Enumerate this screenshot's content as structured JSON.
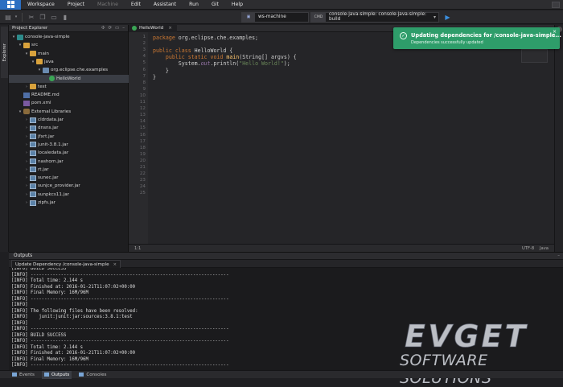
{
  "menu": {
    "items": [
      {
        "label": "Workspace",
        "enabled": true
      },
      {
        "label": "Project",
        "enabled": true
      },
      {
        "label": "Machine",
        "enabled": false
      },
      {
        "label": "Edit",
        "enabled": true
      },
      {
        "label": "Assistant",
        "enabled": true
      },
      {
        "label": "Run",
        "enabled": true
      },
      {
        "label": "Git",
        "enabled": true
      },
      {
        "label": "Help",
        "enabled": true
      }
    ]
  },
  "toolbar": {
    "machine": "ws-machine",
    "cmd_badge": "CMD",
    "command": "console-java-simple: console-java-simple: build"
  },
  "side": {
    "explorer_tab": "Explorer"
  },
  "explorer": {
    "title": "Project Explorer",
    "tree": [
      {
        "label": "console-java-simple",
        "depth": 0,
        "arrow": "▾",
        "icon": "proj"
      },
      {
        "label": "src",
        "depth": 1,
        "arrow": "▾",
        "icon": "folder"
      },
      {
        "label": "main",
        "depth": 2,
        "arrow": "▾",
        "icon": "folder"
      },
      {
        "label": "java",
        "depth": 3,
        "arrow": "▾",
        "icon": "folder"
      },
      {
        "label": "org.eclipse.che.examples",
        "depth": 4,
        "arrow": "▾",
        "icon": "pkg"
      },
      {
        "label": "HelloWorld",
        "depth": 5,
        "arrow": "",
        "icon": "class",
        "selected": true
      },
      {
        "label": "test",
        "depth": 2,
        "arrow": "›",
        "icon": "folder"
      },
      {
        "label": "README.md",
        "depth": 1,
        "arrow": "",
        "icon": "md"
      },
      {
        "label": "pom.xml",
        "depth": 1,
        "arrow": "",
        "icon": "xml"
      },
      {
        "label": "External Libraries",
        "depth": 1,
        "arrow": "▾",
        "icon": "lib"
      },
      {
        "label": "cldrdata.jar",
        "depth": 2,
        "arrow": "›",
        "icon": "jar"
      },
      {
        "label": "dnsns.jar",
        "depth": 2,
        "arrow": "›",
        "icon": "jar"
      },
      {
        "label": "jfxrt.jar",
        "depth": 2,
        "arrow": "›",
        "icon": "jar"
      },
      {
        "label": "junit-3.8.1.jar",
        "depth": 2,
        "arrow": "›",
        "icon": "jar"
      },
      {
        "label": "localedata.jar",
        "depth": 2,
        "arrow": "›",
        "icon": "jar"
      },
      {
        "label": "nashorn.jar",
        "depth": 2,
        "arrow": "›",
        "icon": "jar"
      },
      {
        "label": "rt.jar",
        "depth": 2,
        "arrow": "›",
        "icon": "jar"
      },
      {
        "label": "sunec.jar",
        "depth": 2,
        "arrow": "›",
        "icon": "jar"
      },
      {
        "label": "sunjce_provider.jar",
        "depth": 2,
        "arrow": "›",
        "icon": "jar"
      },
      {
        "label": "sunpkcs11.jar",
        "depth": 2,
        "arrow": "›",
        "icon": "jar"
      },
      {
        "label": "zipfs.jar",
        "depth": 2,
        "arrow": "›",
        "icon": "jar"
      }
    ]
  },
  "editor": {
    "tab_label": "HelloWorld",
    "tab_close": "×",
    "line_numbers": [
      "1",
      "2",
      "3",
      "4",
      "5",
      "6",
      "7",
      "8",
      "9",
      "10",
      "11",
      "12",
      "13",
      "14",
      "15",
      "16",
      "17",
      "18",
      "19",
      "20",
      "21",
      "22",
      "23",
      "24",
      "25"
    ],
    "code_lines": [
      "package org.eclipse.che.examples;",
      "",
      "public class HelloWorld {",
      "    public static void main(String[] argvs) {",
      "        System.out.println(\"Hello World!\");",
      "    }",
      "}"
    ],
    "status": {
      "position": "1:1",
      "encoding": "UTF-8",
      "language": "Java"
    }
  },
  "notification": {
    "title": "Updating dependencies for /console-java-simple...",
    "subtitle": "Dependencies successfully updated",
    "close": "×"
  },
  "outputs": {
    "title": "Outputs",
    "tab_label": "Update Dependency /console-java-simple",
    "tab_close": "×",
    "lines": [
      "[INFO] BUILD SUCCESS",
      "[INFO] ------------------------------------------------------------------------",
      "[INFO] Total time: 2.144 s",
      "[INFO] Finished at: 2016-01-21T11:07:02+00:00",
      "[INFO] Final Memory: 16M/96M",
      "[INFO] ------------------------------------------------------------------------",
      "[INFO]",
      "[INFO] The following files have been resolved:",
      "[INFO]    junit:junit:jar:sources:3.8.1:test",
      "[INFO]",
      "[INFO] ------------------------------------------------------------------------",
      "[INFO] BUILD SUCCESS",
      "[INFO] ------------------------------------------------------------------------",
      "[INFO] Total time: 2.144 s",
      "[INFO] Finished at: 2016-01-21T11:07:02+00:00",
      "[INFO] Final Memory: 16M/96M",
      "[INFO] ------------------------------------------------------------------------"
    ]
  },
  "watermark": {
    "brand": "EVGET",
    "tagline": "SOFTWARE SOLUTIONS"
  },
  "bottom_tabs": [
    {
      "label": "Events",
      "active": false
    },
    {
      "label": "Outputs",
      "active": true
    },
    {
      "label": "Consoles",
      "active": false
    }
  ],
  "colors": {
    "accent": "#2b6fc2",
    "notification": "#2e9d6a",
    "run": "#3b8fdf"
  }
}
